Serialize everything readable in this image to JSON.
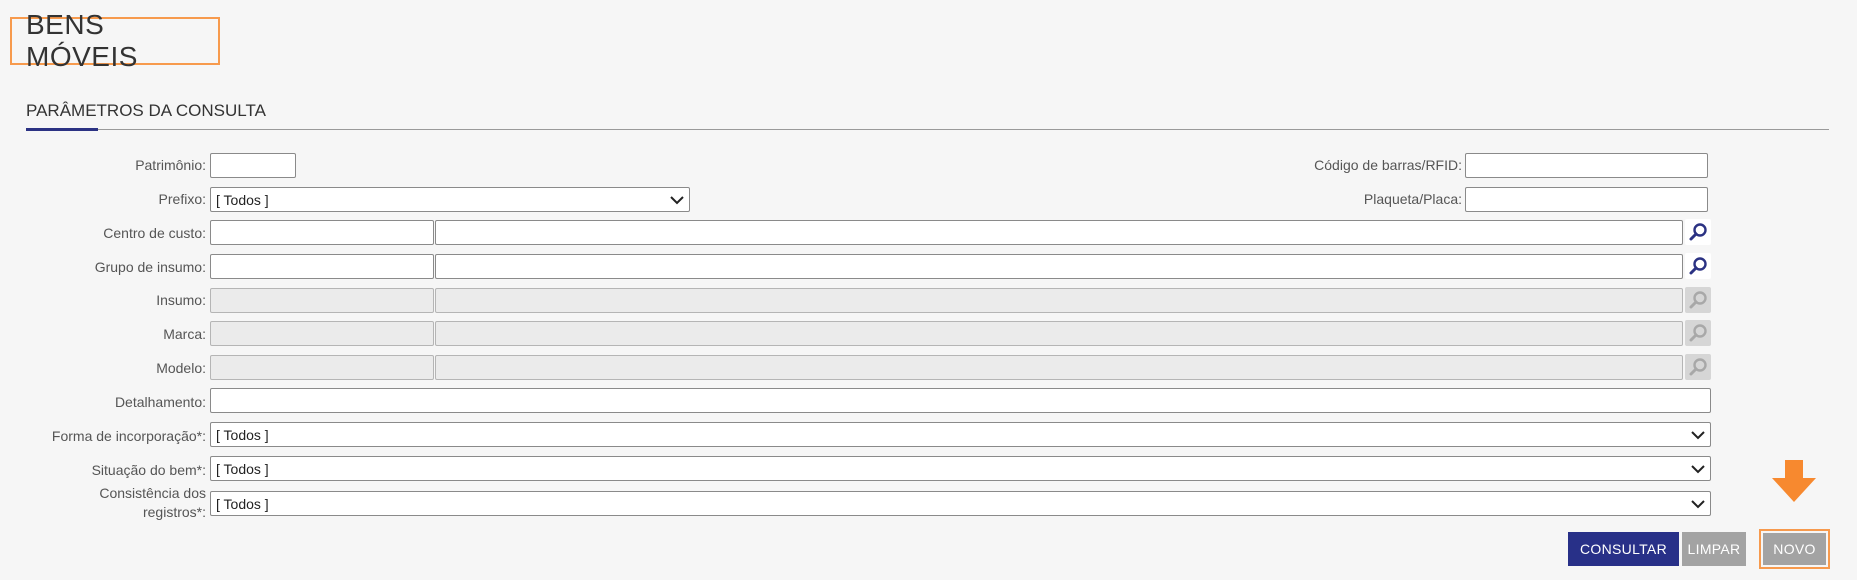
{
  "page": {
    "title": "BENS MÓVEIS"
  },
  "section": {
    "title": "PARÂMETROS DA CONSULTA"
  },
  "fields": {
    "patrimonio": {
      "label": "Patrimônio:",
      "value": ""
    },
    "codigo_barras": {
      "label": "Código de barras/RFID:",
      "value": ""
    },
    "prefixo": {
      "label": "Prefixo:",
      "selected": "[ Todos ]"
    },
    "plaqueta": {
      "label": "Plaqueta/Placa:",
      "value": ""
    },
    "centro_custo": {
      "label": "Centro de custo:",
      "code": "",
      "description": ""
    },
    "grupo_insumo": {
      "label": "Grupo de insumo:",
      "code": "",
      "description": ""
    },
    "insumo": {
      "label": "Insumo:",
      "code": "",
      "description": ""
    },
    "marca": {
      "label": "Marca:",
      "code": "",
      "description": ""
    },
    "modelo": {
      "label": "Modelo:",
      "code": "",
      "description": ""
    },
    "detalhamento": {
      "label": "Detalhamento:",
      "value": ""
    },
    "forma_incorporacao": {
      "label": "Forma de incorporação*:",
      "selected": "[ Todos ]"
    },
    "situacao_bem": {
      "label": "Situação do bem*:",
      "selected": "[ Todos ]"
    },
    "consistencia": {
      "label": "Consistência dos registros*:",
      "selected": "[ Todos ]"
    }
  },
  "buttons": {
    "consultar": "CONSULTAR",
    "limpar": "LIMPAR",
    "novo": "NOVO"
  },
  "icons": {
    "lookup": "search-icon",
    "dropdown": "chevron-down-icon",
    "highlight": "arrow-down-icon"
  },
  "colors": {
    "primary": "#283088",
    "secondary": "#a3a3a3",
    "highlight": "#f79a4d",
    "lookup_active": "#2b3283",
    "lookup_disabled": "#a8a8a8"
  }
}
